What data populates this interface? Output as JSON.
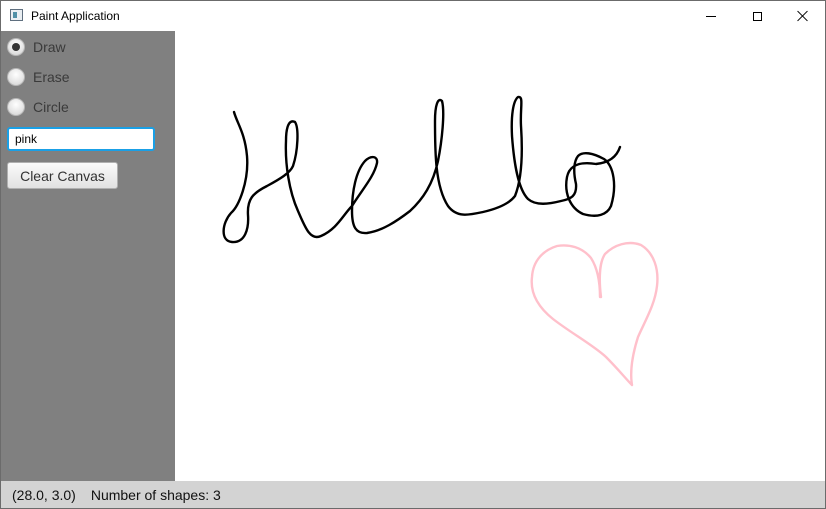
{
  "window": {
    "title": "Paint Application",
    "icon": "app-icon"
  },
  "tools": [
    {
      "label": "Draw",
      "selected": true
    },
    {
      "label": "Erase",
      "selected": false
    },
    {
      "label": "Circle",
      "selected": false
    }
  ],
  "color_input": {
    "value": "pink"
  },
  "clear_button": {
    "label": "Clear Canvas"
  },
  "canvas": {
    "strokes": [
      {
        "name": "hello-stroke",
        "color": "#000000"
      },
      {
        "name": "heart-stroke",
        "color": "#ffc0cb"
      }
    ]
  },
  "status": {
    "coords": "(28.0, 3.0)",
    "shapes": "Number of shapes: 3"
  }
}
